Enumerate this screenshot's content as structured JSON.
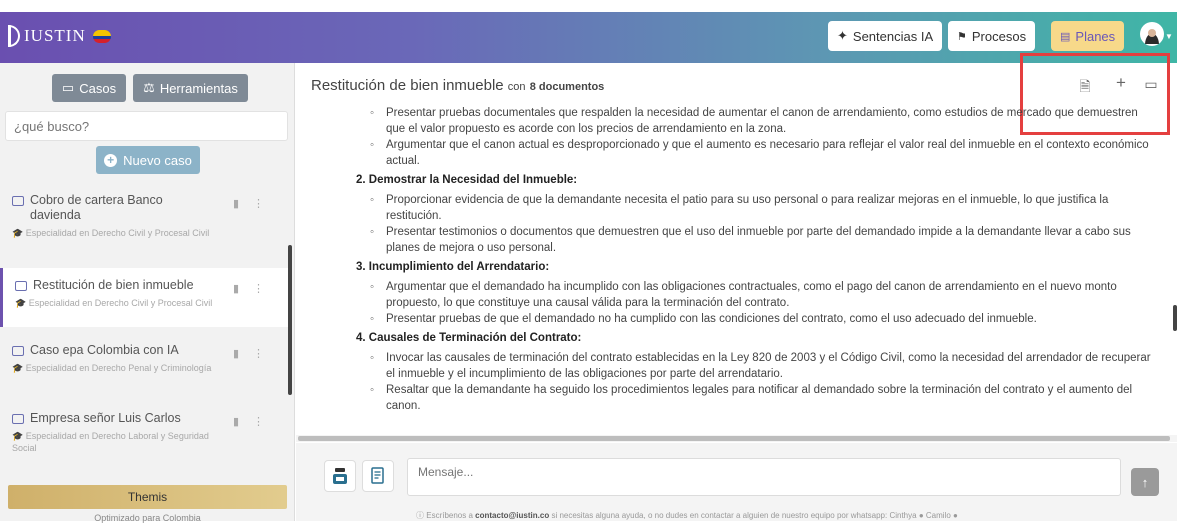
{
  "header": {
    "brand": "IUSTIN",
    "buttons": {
      "sentencias": "Sentencias IA",
      "procesos": "Procesos",
      "planes": "Planes"
    }
  },
  "sidebar": {
    "casos_label": "Casos",
    "herramientas_label": "Herramientas",
    "search_placeholder": "¿qué busco?",
    "new_case_label": "Nuevo caso",
    "cases": [
      {
        "title": "Cobro de cartera Banco davienda",
        "subtitle": "Especialidad en Derecho Civil y Procesal Civil"
      },
      {
        "title": "Restitución de bien inmueble",
        "subtitle": "Especialidad en Derecho Civil y Procesal Civil"
      },
      {
        "title": "Caso epa Colombia con IA",
        "subtitle": "Especialidad en Derecho Penal y Criminología"
      },
      {
        "title": "Empresa señor Luis Carlos",
        "subtitle": "Especialidad en Derecho Laboral y Seguridad Social"
      }
    ],
    "themis_label": "Themis",
    "optimized_label": "Optimizado para Colombia"
  },
  "main": {
    "title": "Restitución de bien inmueble",
    "title_con": "con",
    "doc_count": "8 documentos",
    "doc": {
      "b1": "Presentar pruebas documentales que respalden la necesidad de aumentar el canon de arrendamiento, como estudios de mercado que demuestren que el valor propuesto es acorde con los precios de arrendamiento en la zona.",
      "b2": "Argumentar que el canon actual es desproporcionado y que el aumento es necesario para reflejar el valor real del inmueble en el contexto económico actual.",
      "h2": "2. Demostrar la Necesidad del Inmueble:",
      "b3": "Proporcionar evidencia de que la demandante necesita el patio para su uso personal o para realizar mejoras en el inmueble, lo que justifica la restitución.",
      "b4": "Presentar testimonios o documentos que demuestren que el uso del inmueble por parte del demandado impide a la demandante llevar a cabo sus planes de mejora o uso personal.",
      "h3": "3. Incumplimiento del Arrendatario:",
      "b5": "Argumentar que el demandado ha incumplido con las obligaciones contractuales, como el pago del canon de arrendamiento en el nuevo monto propuesto, lo que constituye una causal válida para la terminación del contrato.",
      "b6": "Presentar pruebas de que el demandado no ha cumplido con las condiciones del contrato, como el uso adecuado del inmueble.",
      "h4": "4. Causales de Terminación del Contrato:",
      "b7": "Invocar las causales de terminación del contrato establecidas en la Ley 820 de 2003 y el Código Civil, como la necesidad del arrendador de recuperar el inmueble y el incumplimiento de las obligaciones por parte del arrendatario.",
      "b8": "Resaltar que la demandante ha seguido los procedimientos legales para notificar al demandado sobre la terminación del contrato y el aumento del canon."
    },
    "composer_placeholder": "Mensaje...",
    "footer_prefix": "Escríbenos a",
    "footer_email": "contacto@iustin.co",
    "footer_suffix": "si necesitas alguna ayuda, o no dudes en contactar a alguien de nuestro equipo por whatsapp: Cinthya",
    "footer_name2": "Camilo"
  },
  "colors": {
    "accent": "#6d52ae",
    "highlight_box": "#e43f3f",
    "themis": "#d6bd7a"
  }
}
